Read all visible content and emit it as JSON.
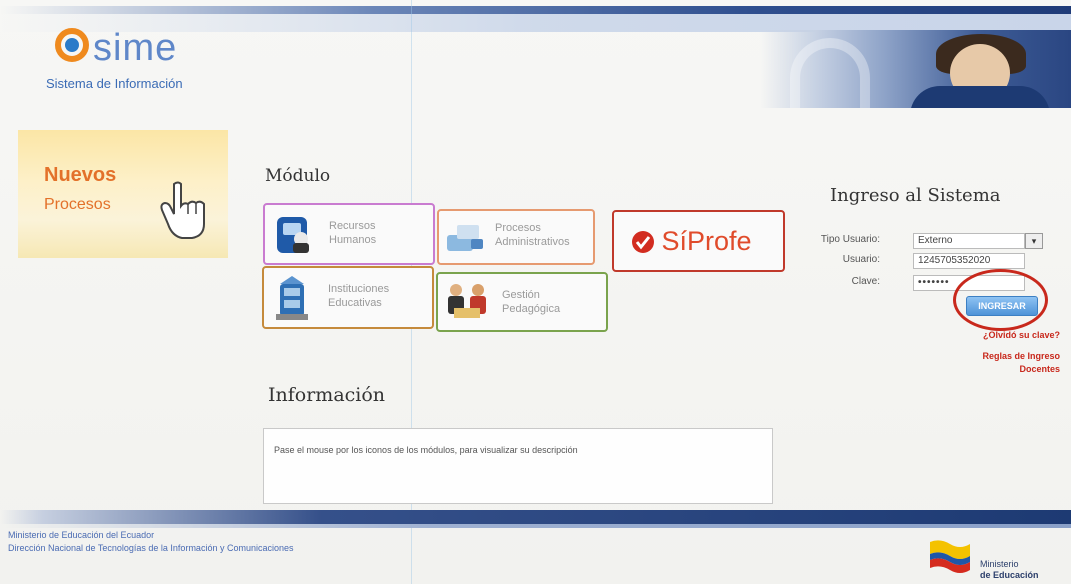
{
  "header": {
    "logo_name": "sime",
    "logo_subtitle": "Sistema de Información"
  },
  "promo": {
    "title": "Nuevos",
    "subtitle": "Procesos"
  },
  "modulo": {
    "title": "Módulo",
    "cards": [
      {
        "label": "Recursos\nHumanos"
      },
      {
        "label": "Procesos\nAdministrativos"
      },
      {
        "label": "SíProfe"
      },
      {
        "label": "Instituciones\nEducativas"
      },
      {
        "label": "Gestión\nPedagógica"
      }
    ]
  },
  "informacion": {
    "title": "Información",
    "text": "Pase el mouse por los iconos de los módulos, para visualizar su descripción"
  },
  "login": {
    "title": "Ingreso al Sistema",
    "tipo_usuario_label": "Tipo Usuario:",
    "tipo_usuario_value": "Externo",
    "usuario_label": "Usuario:",
    "usuario_value": "1245705352020",
    "clave_label": "Clave:",
    "clave_value": "•••••••",
    "button": "INGRESAR",
    "link_olvido": "¿Olvidó su clave?",
    "link_reglas_1": "Reglas de Ingreso",
    "link_reglas_2": "Docentes"
  },
  "footer": {
    "line1": "Ministerio de Educación del Ecuador",
    "line2": "Dirección Nacional de Tecnologías de la Información y Comunicaciones",
    "ministerio_1": "Ministerio",
    "ministerio_2": "de Educación"
  }
}
